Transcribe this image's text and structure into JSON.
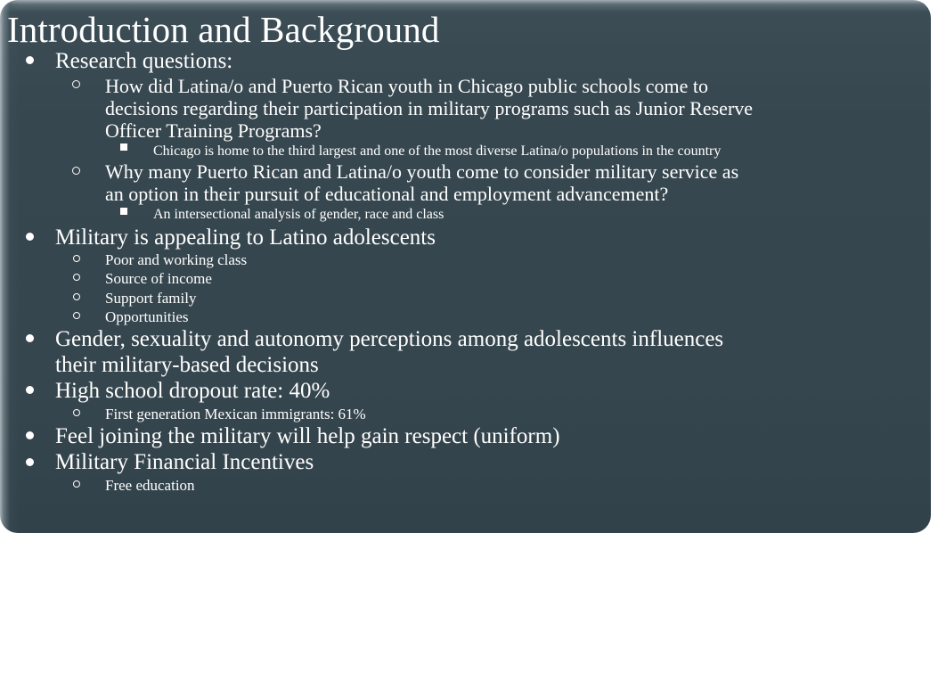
{
  "slide": {
    "title": "Introduction and Background",
    "theme": {
      "background_color": "#37474f",
      "text_color": "#ffffff",
      "edge_highlight_color": "#bec8cd"
    },
    "bullets": [
      {
        "level": 1,
        "marker": "filled-disc",
        "text": "Research questions:"
      },
      {
        "level": 2,
        "marker": "hollow-circle",
        "size": "large",
        "text": "How did Latina/o and Puerto Rican youth in Chicago public schools come to decisions regarding their participation in military programs such as Junior Reserve Officer Training Programs?"
      },
      {
        "level": 3,
        "marker": "filled-square",
        "text": "Chicago is home to the third largest and one of the most diverse Latina/o populations in the country"
      },
      {
        "level": 2,
        "marker": "hollow-circle",
        "size": "large",
        "text": "Why many Puerto Rican and Latina/o youth come to consider military service as an option in their pursuit of educational and employment advancement?"
      },
      {
        "level": 3,
        "marker": "filled-square",
        "text": "An intersectional analysis of gender, race and class"
      },
      {
        "level": 1,
        "marker": "filled-disc",
        "text": "Military is appealing to Latino adolescents"
      },
      {
        "level": 2,
        "marker": "hollow-circle",
        "size": "small",
        "text": "Poor and working class"
      },
      {
        "level": 2,
        "marker": "hollow-circle",
        "size": "small",
        "text": "Source of income"
      },
      {
        "level": 2,
        "marker": "hollow-circle",
        "size": "small",
        "text": "Support family"
      },
      {
        "level": 2,
        "marker": "hollow-circle",
        "size": "small",
        "text": "Opportunities"
      },
      {
        "level": 1,
        "marker": "filled-disc",
        "text": "Gender, sexuality and autonomy perceptions among adolescents influences their military-based decisions"
      },
      {
        "level": 1,
        "marker": "filled-disc",
        "text": "High school dropout rate: 40%"
      },
      {
        "level": 2,
        "marker": "hollow-circle",
        "size": "small",
        "text": "First generation Mexican immigrants: 61%"
      },
      {
        "level": 1,
        "marker": "filled-disc",
        "text": "Feel joining the military will help gain respect (uniform)"
      },
      {
        "level": 1,
        "marker": "filled-disc",
        "text": "Military Financial Incentives"
      },
      {
        "level": 2,
        "marker": "hollow-circle",
        "size": "small",
        "text": "Free education"
      }
    ]
  }
}
